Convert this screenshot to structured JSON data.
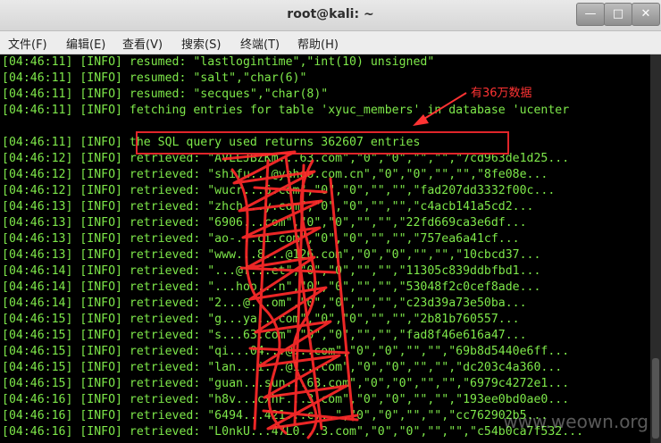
{
  "window": {
    "title": "root@kali: ~",
    "controls": [
      "minimize",
      "maximize",
      "close"
    ]
  },
  "menu": [
    "文件(F)",
    "编辑(E)",
    "查看(V)",
    "搜索(S)",
    "终端(T)",
    "帮助(H)"
  ],
  "terminal": {
    "lines": [
      "[04:46:11] [INFO] resumed: \"lastlogintime\",\"int(10) unsigned\"",
      "[04:46:11] [INFO] resumed: \"salt\",\"char(6)\"",
      "[04:46:11] [INFO] resumed: \"secques\",\"char(8)\"",
      "[04:46:11] [INFO] fetching entries for table 'xyuc_members' in database 'ucenter",
      "",
      "[04:46:11] [INFO] the SQL query used returns 362607 entries",
      "[04:46:12] [INFO] retrieved: \"AVLLJBZKm...63.com\",\"0\",\"0\",\"\",\"\",\"7cd963de1d25...",
      "[04:46:12] [INFO] retrieved: \"shifu...@yahoo.com.cn\",\"0\",\"0\",\"\",\"\",\"8fe08e...",
      "[04:46:12] [INFO] retrieved: \"wucr...6.com\",\"0\",\"0\",\"\",\"\",\"fad207dd3332f00c...",
      "[04:46:13] [INFO] retrieved: \"zhch...y.com\",\"0\",\"0\",\"\",\"\",\"c4acb141a5cd2...",
      "[04:46:13] [INFO] retrieved: \"6906...com\",\"0\",\"0\",\"\",\"\",\"22fd669ca3e6df...",
      "[04:46:13] [INFO] retrieved: \"ao-...ci.com\",\"0\",\"0\",\"\",\"\",\"757ea6a41cf...",
      "[04:46:13] [INFO] retrieved: \"www...8...@126.com\",\"0\",\"0\",\"\",\"\",\"10cbcd37...",
      "[04:46:14] [INFO] retrieved: \"...@f...et\",\"0\",\"0\",\"\",\"\",\"11305c839ddbfbd1...",
      "[04:46:14] [INFO] retrieved: \"...hoo...n\",\"0\",\"0\",\"\",\"\",\"53048f2c0cef8ade...",
      "[04:46:14] [INFO] retrieved: \"2...@...om\",\"0\",\"0\",\"\",\"\",\"c23d39a73e50ba...",
      "[04:46:15] [INFO] retrieved: \"g...ya...com\",\"0\",\"0\",\"\",\"\",\"2b81b760557...",
      "[04:46:15] [INFO] retrieved: \"s...63.com\",\"0\",\"0\",\"\",\"\",\"fad8f46e616a47...",
      "[04:46:15] [INFO] retrieved: \"qi...04...@...com\",\"0\",\"0\",\"\",\"\",\"69b8d5440e6ff...",
      "[04:46:15] [INFO] retrieved: \"lan...i...@1...com\",\"0\",\"0\",\"\",\"\",\"dc203c4a360...",
      "[04:46:15] [INFO] retrieved: \"guan...sun...63.com\",\"0\",\"0\",\"\",\"\",\"6979c4272e1...",
      "[04:46:16] [INFO] retrieved: \"h8v...cxhF...3.com\",\"0\",\"0\",\"\",\"\",\"193ee0bd0ae0...",
      "[04:46:16] [INFO] retrieved: \"6494...421...c...\",\"0\",\"0\",\"\",\"\",\"cc762902b5...",
      "[04:46:16] [INFO] retrieved: \"L0nkU...47L0...3.com\",\"0\",\"0\",\"\",\"\",\"c54b0ca7f532..."
    ]
  },
  "annotation": {
    "text": "有36万数据",
    "color": "#ff3333"
  },
  "watermark": "www.weown.org",
  "colors": {
    "terminal_text": "#7ee84a",
    "highlight_box": "#e0252a",
    "redaction": "#ff2a2a"
  }
}
